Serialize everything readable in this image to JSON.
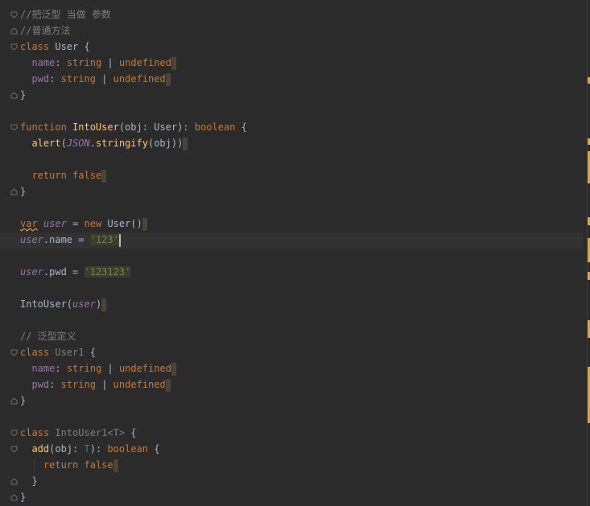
{
  "editor": {
    "lines": {
      "l1": "//把泛型 当做 参数",
      "l2": "//普通方法",
      "l3_kw": "class",
      "l3_name": "User",
      "l3_brace": "{",
      "l4_prop": "name",
      "l4_colon": ":",
      "l4_type": "string",
      "l4_bar": "|",
      "l4_und": "undefined",
      "l5_prop": "pwd",
      "l5_colon": ":",
      "l5_type": "string",
      "l5_bar": "|",
      "l5_und": "undefined",
      "l6": "}",
      "l8_kw": "function",
      "l8_fn": "IntoUser",
      "l8_open": "(obj: User):",
      "l8_ret": "boolean",
      "l8_brace": "{",
      "l9_fn": "alert",
      "l9_open": "(",
      "l9_json": "JSON",
      "l9_dot": ".",
      "l9_call": "stringify",
      "l9_args": "(obj))",
      "l11_kw": "return",
      "l11_val": "false",
      "l12": "}",
      "l14_kw": "var",
      "l14_var": "user",
      "l14_eq": "=",
      "l14_new": "new",
      "l14_ctor": "User()",
      "l15_var": "user",
      "l15_rest": ".name =",
      "l15_str": "'123'",
      "l17_var": "user",
      "l17_rest": ".pwd =",
      "l17_str": "'123123'",
      "l19_fn": "IntoUser(",
      "l19_var": "user",
      "l19_close": ")",
      "l21": "// 泛型定义",
      "l22_kw": "class",
      "l22_name": "User1",
      "l22_brace": "{",
      "l23_prop": "name",
      "l23_colon": ":",
      "l23_type": "string",
      "l23_bar": "|",
      "l23_und": "undefined",
      "l24_prop": "pwd",
      "l24_colon": ":",
      "l24_type": "string",
      "l24_bar": "|",
      "l24_und": "undefined",
      "l25": "}",
      "l27_kw": "class",
      "l27_name": "IntoUser1<T>",
      "l27_brace": "{",
      "l28_fn": "add",
      "l28_open": "(obj:",
      "l28_tp": "T",
      "l28_close": "):",
      "l28_ret": "boolean",
      "l28_brace": "{",
      "l29_kw": "return",
      "l29_val": "false",
      "l30": "}",
      "l31": "}"
    }
  },
  "colors": {
    "background": "#2b2b2b",
    "keyword": "#cc7832",
    "comment": "#808080",
    "function": "#ffc66d",
    "property": "#9876aa",
    "string": "#6a8759",
    "caret_row": "#323232",
    "marker": "#d9a343"
  }
}
